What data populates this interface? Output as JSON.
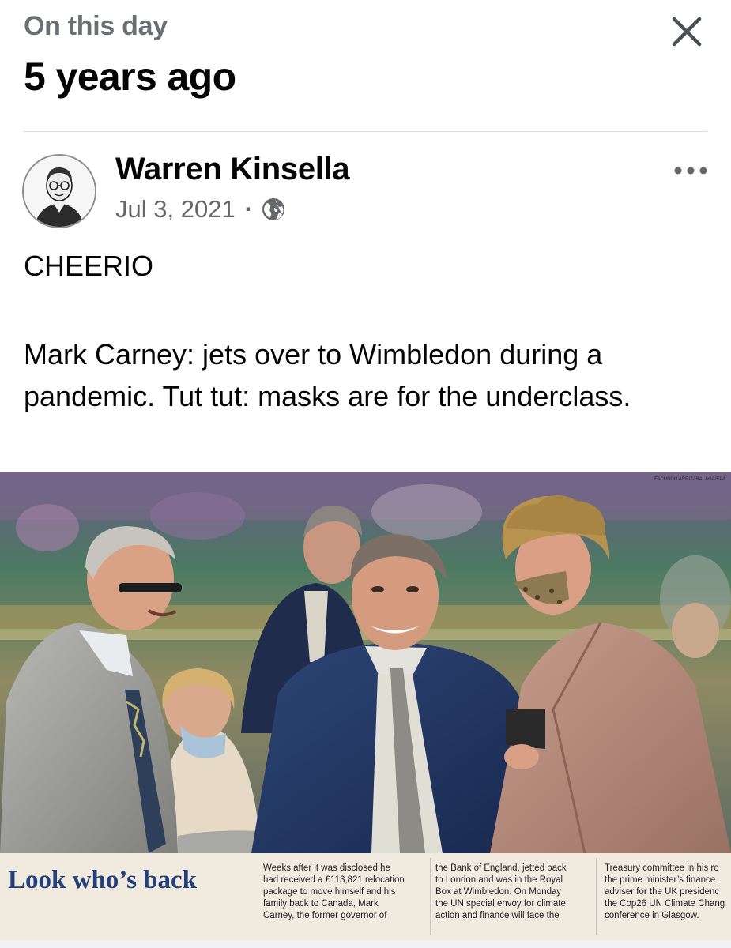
{
  "memory": {
    "label": "On this day",
    "title": "5 years ago",
    "close_icon": "close-icon"
  },
  "post": {
    "author": "Warren Kinsella",
    "date": "Jul 3, 2021",
    "separator": "·",
    "privacy_icon": "globe-icon",
    "more_icon": "more-horizontal-icon",
    "text_line_1": "CHEERIO",
    "text_line_2": "Mark Carney: jets over to Wimbledon during a pandemic. Tut tut: masks are for the underclass."
  },
  "clipping": {
    "photo_credit": "FACUNDO ARRIZABALAGA/EPA",
    "headline": "Look who’s back",
    "col1": [
      "Weeks after it was disclosed he",
      "had received a £113,821 relocation",
      "package to move himself and his",
      "family back to Canada, Mark",
      "Carney, the former governor of"
    ],
    "col2": [
      "the Bank of England, jetted back",
      "to London and was in the Royal",
      "Box at Wimbledon. On Monday",
      "the UN special envoy for climate",
      "action and finance will face the"
    ],
    "col3": [
      "Treasury committee in his ro",
      "the prime minister’s finance",
      "adviser for the UK presidenc",
      "the Cop26 UN Climate Chang",
      "conference in Glasgow."
    ]
  },
  "colors": {
    "accent_text": "#050505",
    "secondary_text": "#65676b",
    "headline_blue": "#23407a"
  }
}
